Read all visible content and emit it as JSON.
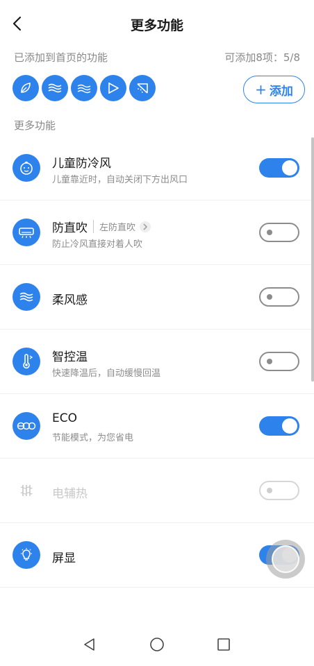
{
  "header": {
    "title": "更多功能"
  },
  "added": {
    "label": "已添加到首页的功能",
    "count_text": "可添加8项：5/8",
    "icons": [
      "leaf-icon",
      "wind-wave-icon",
      "soft-wind-icon",
      "swing-icon",
      "sweep-icon"
    ],
    "add_button_plus": "+",
    "add_button_label": "添加"
  },
  "section_label": "更多功能",
  "features": [
    {
      "name": "儿童防冷风",
      "desc": "儿童靠近时，自动关闭下方出风口",
      "state": "on",
      "icon": "child-face-icon"
    },
    {
      "name": "防直吹",
      "sub": "左防直吹",
      "desc": "防止冷风直接对着人吹",
      "state": "off",
      "icon": "ac-unit-icon"
    },
    {
      "name": "柔风感",
      "state": "off",
      "icon": "soft-wind-icon"
    },
    {
      "name": "智控温",
      "desc": "快速降温后，自动缓慢回温",
      "state": "off",
      "icon": "thermometer-icon"
    },
    {
      "name": "ECO",
      "desc": "节能模式，为您省电",
      "state": "on",
      "icon": "eco-icon"
    },
    {
      "name": "电辅热",
      "state": "disabled",
      "icon": "heater-icon"
    },
    {
      "name": "屏显",
      "state": "on",
      "icon": "bulb-icon"
    }
  ],
  "colors": {
    "accent": "#2e82ec",
    "muted": "#8c8c8c"
  }
}
